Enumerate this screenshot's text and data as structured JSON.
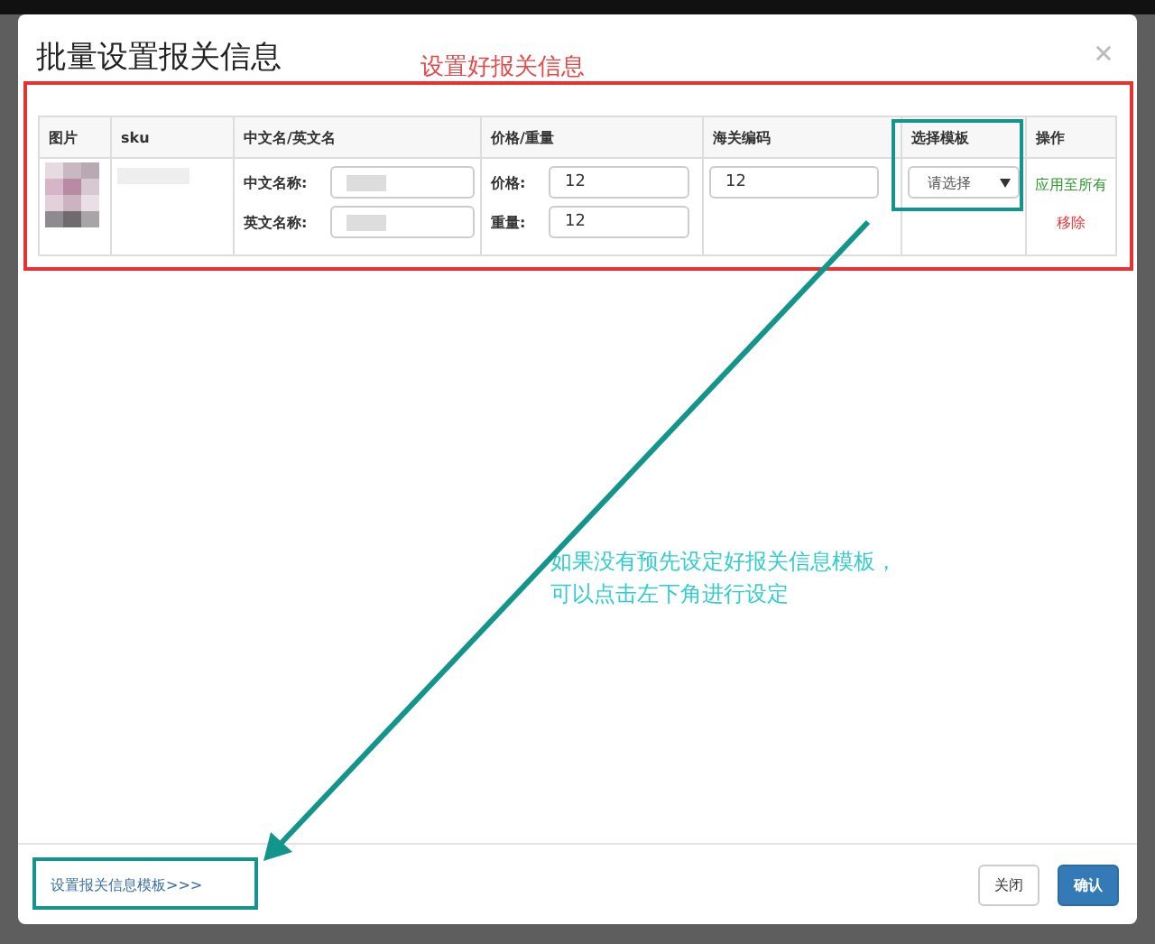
{
  "dialog": {
    "title": "批量设置报关信息",
    "table": {
      "columns": [
        "图片",
        "sku",
        "中文名/英文名",
        "价格/重量",
        "海关编码",
        "选择模板",
        "操作"
      ],
      "rows": [
        {
          "cn_name_label": "中文名称:",
          "en_name_label": "英文名称:",
          "price_label": "价格:",
          "price": "12",
          "weight_label": "重量:",
          "weight": "12",
          "customs_code": "12",
          "template_select": "请选择",
          "apply_all": "应用至所有",
          "remove": "移除"
        }
      ]
    },
    "footer": {
      "template_link": "设置报关信息模板>>>",
      "buttons": [
        {
          "label": "关闭",
          "kind": "default"
        },
        {
          "label": "确认",
          "kind": "primary"
        }
      ]
    }
  },
  "annotations": {
    "table_note": "设置好报关信息",
    "hint_lines": [
      "如果没有预先设定好报关信息模板，",
      "可以点击左下角进行设定"
    ]
  }
}
